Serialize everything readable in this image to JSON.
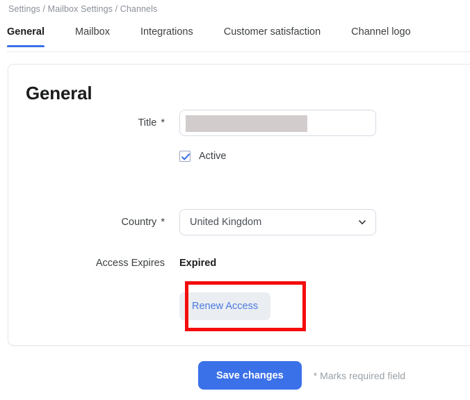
{
  "breadcrumb": {
    "text": "Settings / Mailbox Settings / Channels"
  },
  "tabs": [
    {
      "label": "General",
      "active": true
    },
    {
      "label": "Mailbox",
      "active": false
    },
    {
      "label": "Integrations",
      "active": false
    },
    {
      "label": "Customer satisfaction",
      "active": false
    },
    {
      "label": "Channel logo",
      "active": false
    }
  ],
  "card": {
    "title": "General",
    "fields": {
      "title": {
        "label": "Title",
        "required_marker": "*",
        "value": "",
        "redacted": true
      },
      "active": {
        "label": "Active",
        "checked": true
      },
      "country": {
        "label": "Country",
        "required_marker": "*",
        "value": "United Kingdom",
        "chevron_icon": "chevron-down-icon"
      },
      "access_expires": {
        "label": "Access Expires",
        "value": "Expired"
      },
      "renew": {
        "button_label": "Renew Access"
      }
    }
  },
  "annotation": {
    "color": "#f40c0c",
    "target": "Renew Access"
  },
  "footer": {
    "save_label": "Save changes",
    "required_note": "* Marks required field"
  },
  "colors": {
    "accent_blue": "#3b71e8",
    "ghost_button_text": "#4a7ae0",
    "ghost_button_bg": "#eaedf2",
    "redaction": "#d3cccc",
    "annotation_red": "#f40c0c",
    "muted_text": "#9aa0a6"
  }
}
